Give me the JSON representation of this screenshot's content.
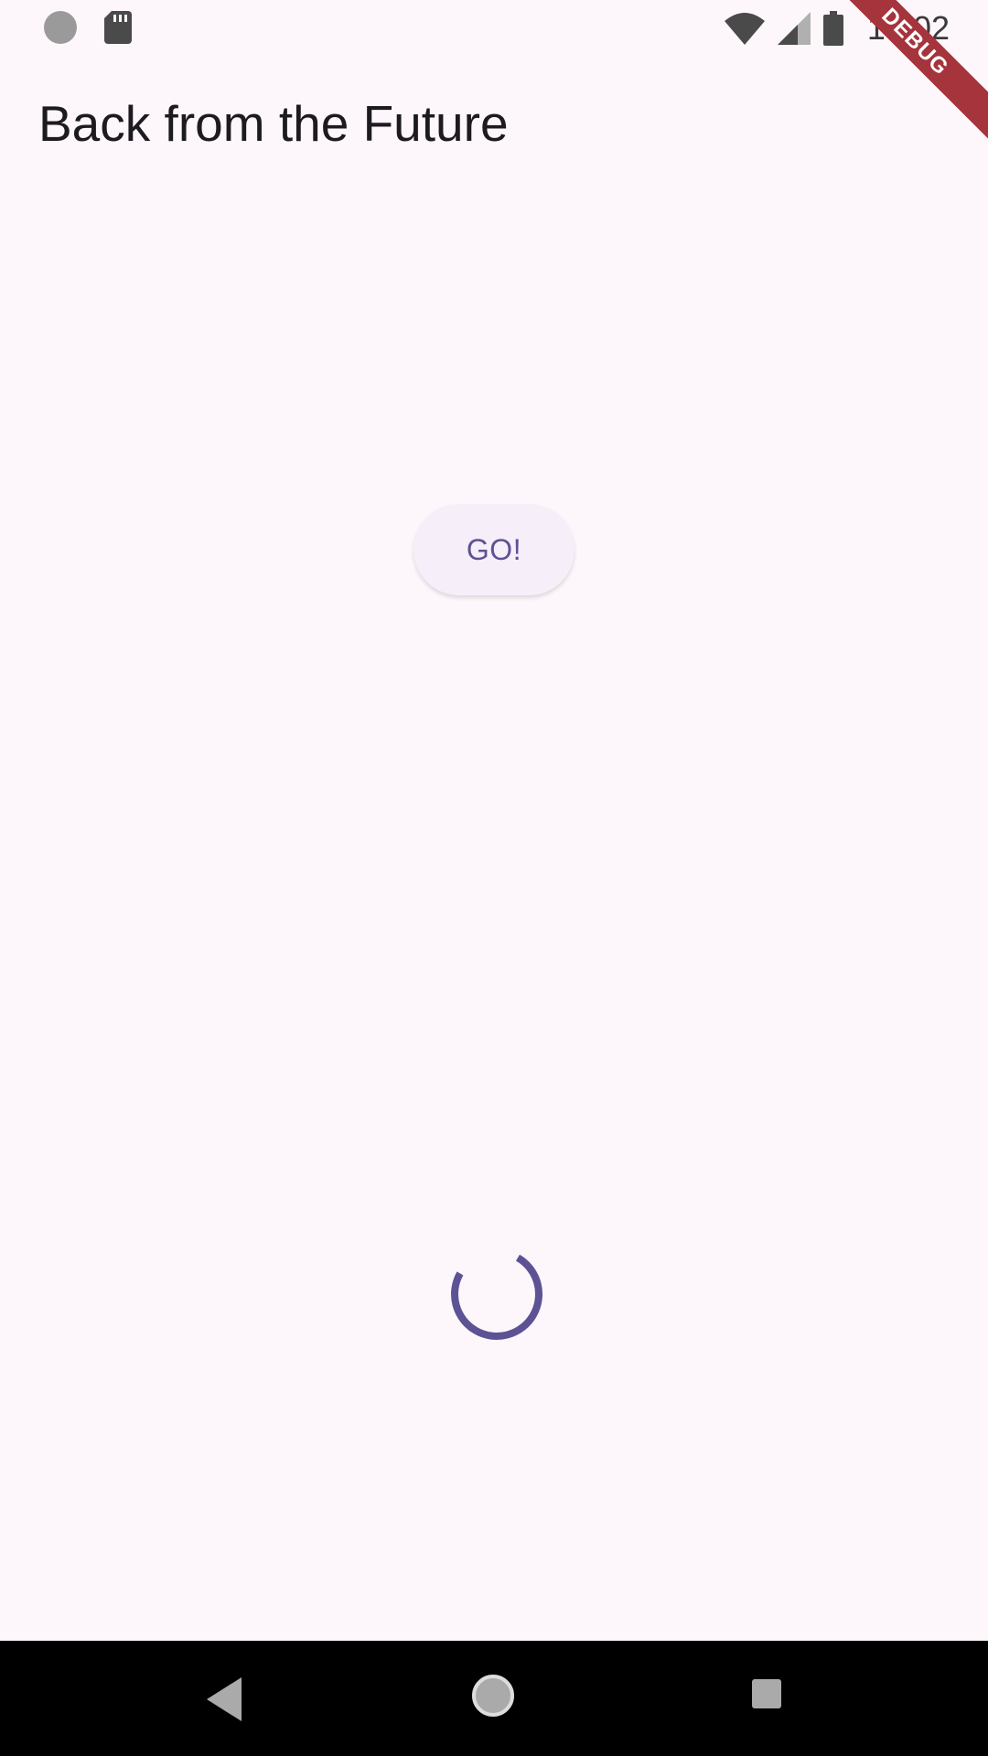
{
  "status_bar": {
    "time": "10:02",
    "icons": [
      "notification-dot-icon",
      "sd-card-icon",
      "wifi-icon",
      "signal-icon",
      "battery-icon"
    ]
  },
  "debug_banner": {
    "label": "DEBUG",
    "color": "#a5343c"
  },
  "app_bar": {
    "title": "Back from the Future"
  },
  "main": {
    "go_button_label": "GO!",
    "progress_state": "indeterminate"
  },
  "navigation_bar": {
    "icons": [
      "back-icon",
      "home-icon",
      "recents-icon"
    ]
  },
  "colors": {
    "background": "#fdf7fb",
    "accent": "#5c5294",
    "nav_bar": "#000000"
  }
}
